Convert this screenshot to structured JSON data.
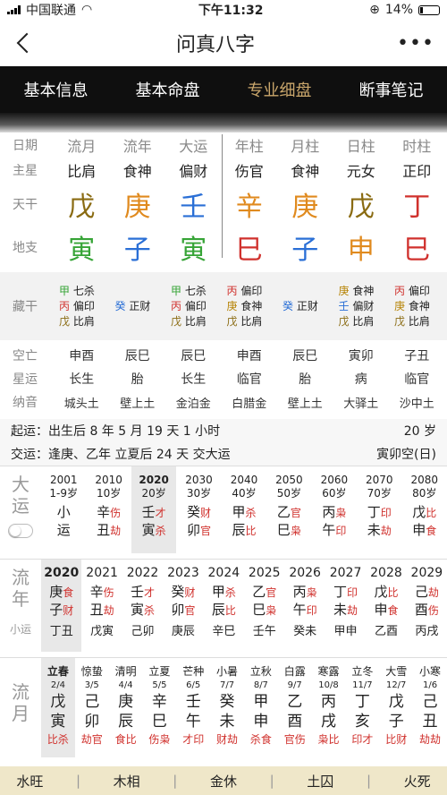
{
  "status": {
    "carrier": "中国联通",
    "time": "下午11:32",
    "battery": "14%"
  },
  "nav": {
    "title": "问真八字"
  },
  "tabs": [
    "基本信息",
    "基本命盘",
    "专业细盘",
    "断事笔记"
  ],
  "header": [
    "日期",
    "流月",
    "流年",
    "大运",
    "年柱",
    "月柱",
    "日柱",
    "时柱"
  ],
  "zhuxing": {
    "label": "主星",
    "values": [
      "比肩",
      "食神",
      "偏财",
      "伤官",
      "食神",
      "元女",
      "正印"
    ]
  },
  "tiangan": {
    "label": "天干",
    "values": [
      "戊",
      "庚",
      "壬",
      "辛",
      "庚",
      "戊",
      "丁"
    ],
    "colors": [
      "#8a6b12",
      "#e08a1e",
      "#2a6fd6",
      "#e08a1e",
      "#e08a1e",
      "#8a6b12",
      "#d0312d"
    ]
  },
  "dizhi": {
    "label": "地支",
    "values": [
      "寅",
      "子",
      "寅",
      "巳",
      "子",
      "申",
      "巳"
    ],
    "colors": [
      "#36a436",
      "#2a6fd6",
      "#36a436",
      "#d0312d",
      "#2a6fd6",
      "#e08a1e",
      "#d0312d"
    ]
  },
  "canggan": {
    "label": "藏干",
    "cols": [
      [
        [
          "甲",
          "七杀"
        ],
        [
          "丙",
          "偏印"
        ],
        [
          "戊",
          "比肩"
        ]
      ],
      [
        [
          "癸",
          "正财"
        ]
      ],
      [
        [
          "甲",
          "七杀"
        ],
        [
          "丙",
          "偏印"
        ],
        [
          "戊",
          "比肩"
        ]
      ],
      [
        [
          "丙",
          "偏印"
        ],
        [
          "庚",
          "食神"
        ],
        [
          "戊",
          "比肩"
        ]
      ],
      [
        [
          "癸",
          "正财"
        ]
      ],
      [
        [
          "庚",
          "食神"
        ],
        [
          "壬",
          "偏财"
        ],
        [
          "戊",
          "比肩"
        ]
      ],
      [
        [
          "丙",
          "偏印"
        ],
        [
          "庚",
          "食神"
        ],
        [
          "戊",
          "比肩"
        ]
      ]
    ]
  },
  "kongwang": {
    "label": "空亡",
    "values": [
      "申酉",
      "辰巳",
      "辰巳",
      "申酉",
      "辰巳",
      "寅卯",
      "子丑"
    ]
  },
  "xingyun": {
    "label": "星运",
    "values": [
      "长生",
      "胎",
      "长生",
      "临官",
      "胎",
      "病",
      "临官"
    ]
  },
  "nayin": {
    "label": "纳音",
    "values": [
      "城头土",
      "壁上土",
      "金泊金",
      "白腊金",
      "壁上土",
      "大驿土",
      "沙中土"
    ]
  },
  "qiyun": {
    "text": "起运：出生后 8 年 5 月 19 天 1 小时",
    "age": "20 岁"
  },
  "jiaoyun": {
    "text": "交运：逢庚、乙年 立夏后 24 天 交大运",
    "kong": "寅卯空(日)"
  },
  "dayun": {
    "label": "大运",
    "items": [
      {
        "year": "2001",
        "age": "1-9岁",
        "g": "小",
        "z": "运",
        "gs": "",
        "zs": ""
      },
      {
        "year": "2010",
        "age": "10岁",
        "g": "辛",
        "z": "丑",
        "gs": "伤",
        "zs": "劫"
      },
      {
        "year": "2020",
        "age": "20岁",
        "g": "壬",
        "z": "寅",
        "gs": "才",
        "zs": "杀"
      },
      {
        "year": "2030",
        "age": "30岁",
        "g": "癸",
        "z": "卯",
        "gs": "财",
        "zs": "官"
      },
      {
        "year": "2040",
        "age": "40岁",
        "g": "甲",
        "z": "辰",
        "gs": "杀",
        "zs": "比"
      },
      {
        "year": "2050",
        "age": "50岁",
        "g": "乙",
        "z": "巳",
        "gs": "官",
        "zs": "枭"
      },
      {
        "year": "2060",
        "age": "60岁",
        "g": "丙",
        "z": "午",
        "gs": "枭",
        "zs": "印"
      },
      {
        "year": "2070",
        "age": "70岁",
        "g": "丁",
        "z": "未",
        "gs": "印",
        "zs": "劫"
      },
      {
        "year": "2080",
        "age": "80岁",
        "g": "戊",
        "z": "申",
        "gs": "比",
        "zs": "食"
      }
    ]
  },
  "liunian": {
    "label": "流年",
    "sub": "小运",
    "items": [
      {
        "year": "2020",
        "g": "庚",
        "z": "子",
        "gs": "食",
        "zs": "财",
        "xy": "丁丑"
      },
      {
        "year": "2021",
        "g": "辛",
        "z": "丑",
        "gs": "伤",
        "zs": "劫",
        "xy": "戊寅"
      },
      {
        "year": "2022",
        "g": "壬",
        "z": "寅",
        "gs": "才",
        "zs": "杀",
        "xy": "己卯"
      },
      {
        "year": "2023",
        "g": "癸",
        "z": "卯",
        "gs": "财",
        "zs": "官",
        "xy": "庚辰"
      },
      {
        "year": "2024",
        "g": "甲",
        "z": "辰",
        "gs": "杀",
        "zs": "比",
        "xy": "辛巳"
      },
      {
        "year": "2025",
        "g": "乙",
        "z": "巳",
        "gs": "官",
        "zs": "枭",
        "xy": "壬午"
      },
      {
        "year": "2026",
        "g": "丙",
        "z": "午",
        "gs": "枭",
        "zs": "印",
        "xy": "癸未"
      },
      {
        "year": "2027",
        "g": "丁",
        "z": "未",
        "gs": "印",
        "zs": "劫",
        "xy": "甲申"
      },
      {
        "year": "2028",
        "g": "戊",
        "z": "申",
        "gs": "比",
        "zs": "食",
        "xy": "乙酉"
      },
      {
        "year": "2029",
        "g": "己",
        "z": "酉",
        "gs": "劫",
        "zs": "伤",
        "xy": "丙戌"
      }
    ]
  },
  "liuyue": {
    "label": "流月",
    "items": [
      {
        "jq": "立春",
        "d": "2/4",
        "g": "戊",
        "z": "寅",
        "ss": "比杀"
      },
      {
        "jq": "惊蛰",
        "d": "3/5",
        "g": "己",
        "z": "卯",
        "ss": "劫官"
      },
      {
        "jq": "清明",
        "d": "4/4",
        "g": "庚",
        "z": "辰",
        "ss": "食比"
      },
      {
        "jq": "立夏",
        "d": "5/5",
        "g": "辛",
        "z": "巳",
        "ss": "伤枭"
      },
      {
        "jq": "芒种",
        "d": "6/5",
        "g": "壬",
        "z": "午",
        "ss": "才印"
      },
      {
        "jq": "小暑",
        "d": "7/7",
        "g": "癸",
        "z": "未",
        "ss": "财劫"
      },
      {
        "jq": "立秋",
        "d": "8/7",
        "g": "甲",
        "z": "申",
        "ss": "杀食"
      },
      {
        "jq": "白露",
        "d": "9/7",
        "g": "乙",
        "z": "酉",
        "ss": "官伤"
      },
      {
        "jq": "寒露",
        "d": "10/8",
        "g": "丙",
        "z": "戌",
        "ss": "枭比"
      },
      {
        "jq": "立冬",
        "d": "11/7",
        "g": "丁",
        "z": "亥",
        "ss": "印才"
      },
      {
        "jq": "大雪",
        "d": "12/7",
        "g": "戊",
        "z": "子",
        "ss": "比财"
      },
      {
        "jq": "小寒",
        "d": "1/6",
        "g": "己",
        "z": "丑",
        "ss": "劫劫"
      }
    ]
  },
  "footer": [
    "水旺",
    "木相",
    "金休",
    "土囚",
    "火死"
  ]
}
